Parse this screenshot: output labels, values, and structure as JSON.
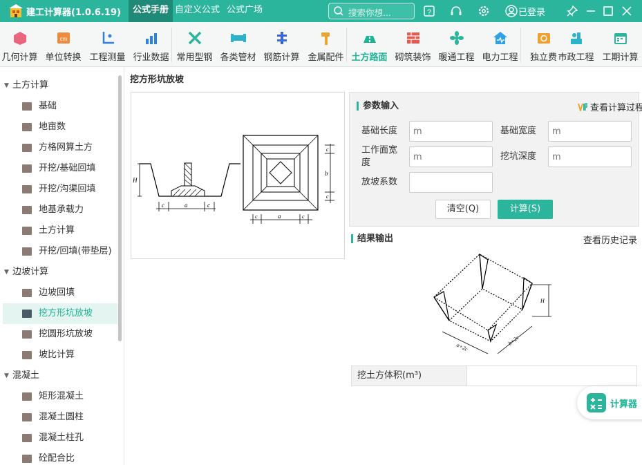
{
  "app": {
    "title": "建工计算器(1.0.6.19)"
  },
  "nav": {
    "tabs": [
      {
        "label": "公式手册",
        "active": true
      },
      {
        "label": "自定义公式"
      },
      {
        "label": "公式广场"
      }
    ]
  },
  "search": {
    "placeholder": "搜索你想..."
  },
  "header_icons": [
    "help-icon",
    "headset-icon",
    "settings-icon"
  ],
  "login": {
    "label": "已登录"
  },
  "window_controls": [
    "pin-icon",
    "minimize-icon",
    "maximize-icon",
    "close-icon"
  ],
  "toolbar": {
    "items": [
      {
        "label": "几何计算",
        "icon": "geometry-icon",
        "color": "#e9667c"
      },
      {
        "label": "单位转换",
        "icon": "unit-convert-icon",
        "color": "#f08a3c"
      },
      {
        "label": "工程测量",
        "icon": "survey-icon",
        "color": "#2f7fe8"
      },
      {
        "label": "行业数据",
        "icon": "chart-icon",
        "color": "#2f7fe8"
      },
      {
        "label": "常用型钢",
        "icon": "steel-icon",
        "color": "#2ab59c"
      },
      {
        "label": "各类管材",
        "icon": "pipe-icon",
        "color": "#2bb3c9"
      },
      {
        "label": "钢筋计算",
        "icon": "rebar-icon",
        "color": "#3a66d6"
      },
      {
        "label": "金属配件",
        "icon": "hammer-icon",
        "color": "#e8a530"
      },
      {
        "label": "土方路面",
        "icon": "road-icon",
        "color": "#1fb395",
        "active": true
      },
      {
        "label": "砌筑装饰",
        "icon": "brick-icon",
        "color": "#e65a4f"
      },
      {
        "label": "暖通工程",
        "icon": "fan-icon",
        "color": "#2ab59c"
      },
      {
        "label": "电力工程",
        "icon": "power-icon",
        "color": "#2f9fe8"
      },
      {
        "label": "独立费",
        "icon": "fee-icon",
        "color": "#f0a030"
      },
      {
        "label": "市政工程",
        "icon": "municipal-icon",
        "color": "#2bb3c9"
      },
      {
        "label": "工期计算",
        "icon": "calendar-icon",
        "color": "#2ab59c"
      }
    ]
  },
  "sidebar": {
    "groups": [
      {
        "label": "土方计算",
        "items": [
          "基础",
          "地亩数",
          "方格网算土方",
          "开挖/基础回填",
          "开挖/沟渠回填",
          "地基承载力",
          "土方计算",
          "开挖/回填(带垫层)"
        ]
      },
      {
        "label": "边坡计算",
        "items": [
          "边坡回填",
          "挖方形坑放坡",
          "挖圆形坑放坡",
          "坡比计算"
        ]
      },
      {
        "label": "混凝土",
        "items": [
          "矩形混凝土",
          "混凝土圆柱",
          "混凝土柱孔",
          "砼配合比"
        ]
      }
    ],
    "active_item": "挖方形坑放坡"
  },
  "page": {
    "heading": "挖方形坑放坡"
  },
  "params": {
    "title": "参数输入",
    "calc_process": "查看计算过程",
    "fields": [
      {
        "label": "基础长度",
        "unit": "m"
      },
      {
        "label": "基础宽度",
        "unit": "m"
      },
      {
        "label": "工作面宽度",
        "unit": "m"
      },
      {
        "label": "挖坑深度",
        "unit": "m"
      },
      {
        "label": "放坡系数",
        "unit": ""
      }
    ],
    "clear_button": "清空(Q)",
    "calc_button": "计算(S)"
  },
  "result": {
    "title": "结果输出",
    "history": "查看历史记录",
    "rows": [
      {
        "label": "挖土方体积(m³)",
        "value": ""
      }
    ]
  },
  "diagram": {
    "labels": [
      "H",
      "c",
      "a",
      "c",
      "c",
      "b",
      "c",
      "c",
      "a",
      "c"
    ]
  },
  "result_diagram": {
    "labels": [
      "H",
      "a+2c",
      "b+2c"
    ]
  },
  "calculator": {
    "label": "计算器"
  },
  "colors": {
    "accent": "#2ab59c",
    "accent_dark": "#1f8a77"
  }
}
